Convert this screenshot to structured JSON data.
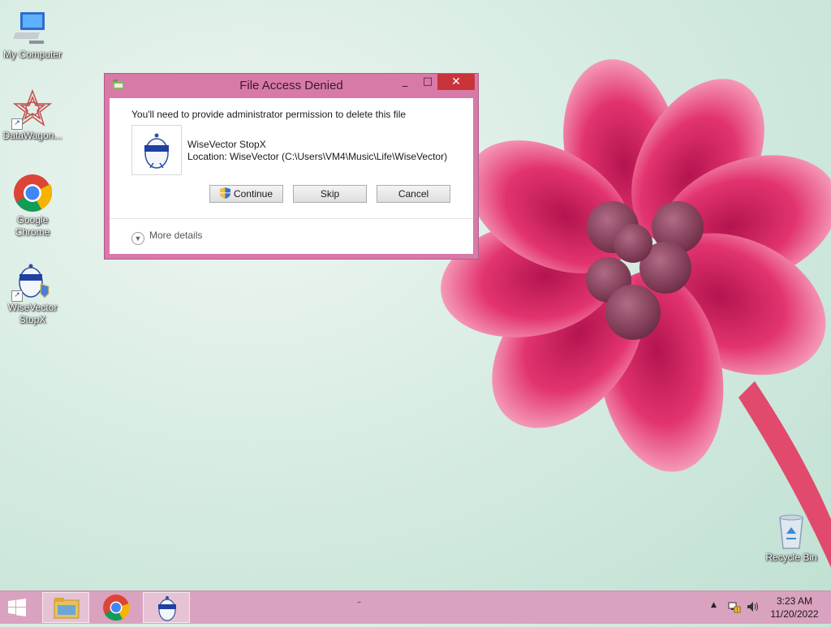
{
  "desktop": {
    "icons": [
      {
        "label": "My Computer",
        "icon": "computer-icon"
      },
      {
        "label": "DataWagon...",
        "icon": "datawagon-icon"
      },
      {
        "label": "Google Chrome",
        "icon": "chrome-icon"
      },
      {
        "label": "WiseVector StopX",
        "icon": "wisevector-icon"
      },
      {
        "label": "Recycle Bin",
        "icon": "recycle-bin-icon"
      }
    ]
  },
  "dialog": {
    "title": "File Access Denied",
    "minimize": "_",
    "maximize": "□",
    "close": "✕",
    "prompt": "You'll need to provide administrator permission to delete this file",
    "file_name": "WiseVector StopX",
    "file_location": "Location: WiseVector (C:\\Users\\VM4\\Music\\Life\\WiseVector)",
    "buttons": {
      "continue": "Continue",
      "skip": "Skip",
      "cancel": "Cancel"
    },
    "more_details": "More details"
  },
  "taskbar": {
    "apps": [
      "file-explorer-icon",
      "chrome-icon",
      "wisevector-icon"
    ],
    "active_app": "wisevector-icon",
    "dash": "–",
    "tray_arrow": "▲",
    "clock_time": "3:23 AM",
    "clock_date": "11/20/2022"
  },
  "colors": {
    "accent": "#d87aa8",
    "close_button": "#c9343a",
    "taskbar": "#d9a2be"
  }
}
